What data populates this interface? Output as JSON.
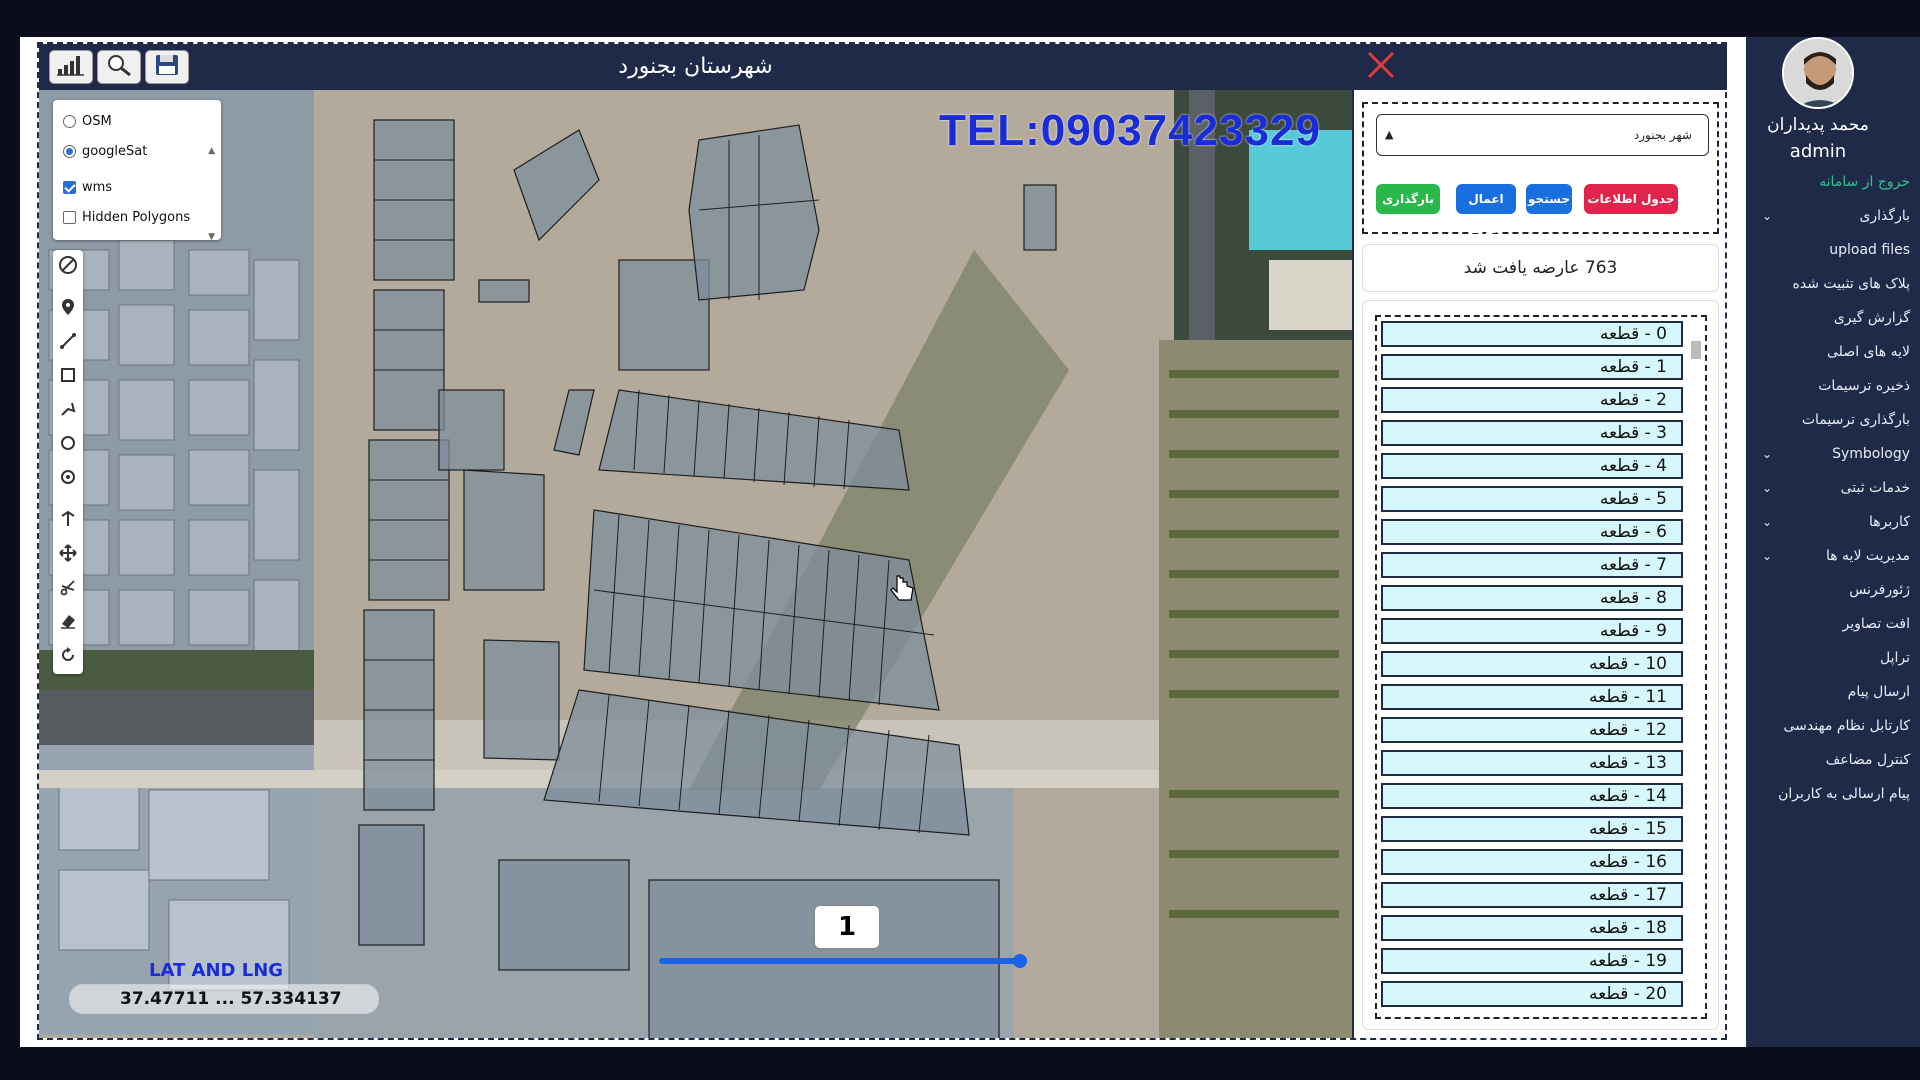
{
  "map": {
    "title": "شهرستان بجنورد",
    "tel": "TEL:09037423329",
    "layers": [
      {
        "label": "OSM",
        "type": "radio",
        "checked": false
      },
      {
        "label": "googleSat",
        "type": "radio",
        "checked": true
      },
      {
        "label": "wms",
        "type": "checkbox",
        "checked": true
      },
      {
        "label": "Hidden Polygons",
        "type": "checkbox",
        "checked": false
      }
    ],
    "latlng_label": "LAT AND LNG",
    "latlng_value": "37.47711 ... 57.334137",
    "page_number": "1",
    "timeline_progress": 0.98
  },
  "panel": {
    "city_select": "شهر بجنورد",
    "buttons": {
      "table": "جدول اطلاعات",
      "search": "جستجو",
      "apply": "اعمال شرط",
      "load": "بارگذاری"
    },
    "result_text": "763 عارضه یافت شد",
    "items": [
      "0 - قطعه",
      "1 - قطعه",
      "2 - قطعه",
      "3 - قطعه",
      "4 - قطعه",
      "5 - قطعه",
      "6 - قطعه",
      "7 - قطعه",
      "8 - قطعه",
      "9 - قطعه",
      "10 - قطعه",
      "11 - قطعه",
      "12 - قطعه",
      "13 - قطعه",
      "14 - قطعه",
      "15 - قطعه",
      "16 - قطعه",
      "17 - قطعه",
      "18 - قطعه",
      "19 - قطعه",
      "20 - قطعه"
    ]
  },
  "sidebar": {
    "user_name": "محمد پدیداران",
    "user_role": "admin",
    "logout": "خروج از سامانه",
    "menu": [
      {
        "label": "بارگذاری",
        "has_children": true
      },
      {
        "label": "upload files",
        "has_children": false
      },
      {
        "label": "پلاک های تثبیت شده",
        "has_children": false
      },
      {
        "label": "گزارش گیری",
        "has_children": false
      },
      {
        "label": "لایه های اصلی",
        "has_children": false
      },
      {
        "label": "ذخیره ترسیمات",
        "has_children": false
      },
      {
        "label": "بارگذاری ترسیمات",
        "has_children": false
      },
      {
        "label": "Symbology",
        "has_children": true
      },
      {
        "label": "خدمات ثبتی",
        "has_children": true
      },
      {
        "label": "کاربرها",
        "has_children": true
      },
      {
        "label": "مدیریت لایه ها",
        "has_children": true
      },
      {
        "label": "ژئورفرنس",
        "has_children": false
      },
      {
        "label": "افت تصاویر",
        "has_children": false
      },
      {
        "label": "تراپل",
        "has_children": false
      },
      {
        "label": "ارسال پیام",
        "has_children": false
      },
      {
        "label": "کارتابل نظام مهندسی",
        "has_children": false
      },
      {
        "label": "کنترل مضاعف",
        "has_children": false
      },
      {
        "label": "پیام ارسالی به کاربران",
        "has_children": false
      }
    ]
  },
  "colors": {
    "navy": "#1e2a47",
    "btn_red": "#e0244b",
    "btn_blue": "#1a6fe0",
    "btn_green": "#2bb84a",
    "list_bg": "#d6f7fc",
    "tel_blue": "#1a2bd8",
    "logout_green": "#31c48d"
  }
}
